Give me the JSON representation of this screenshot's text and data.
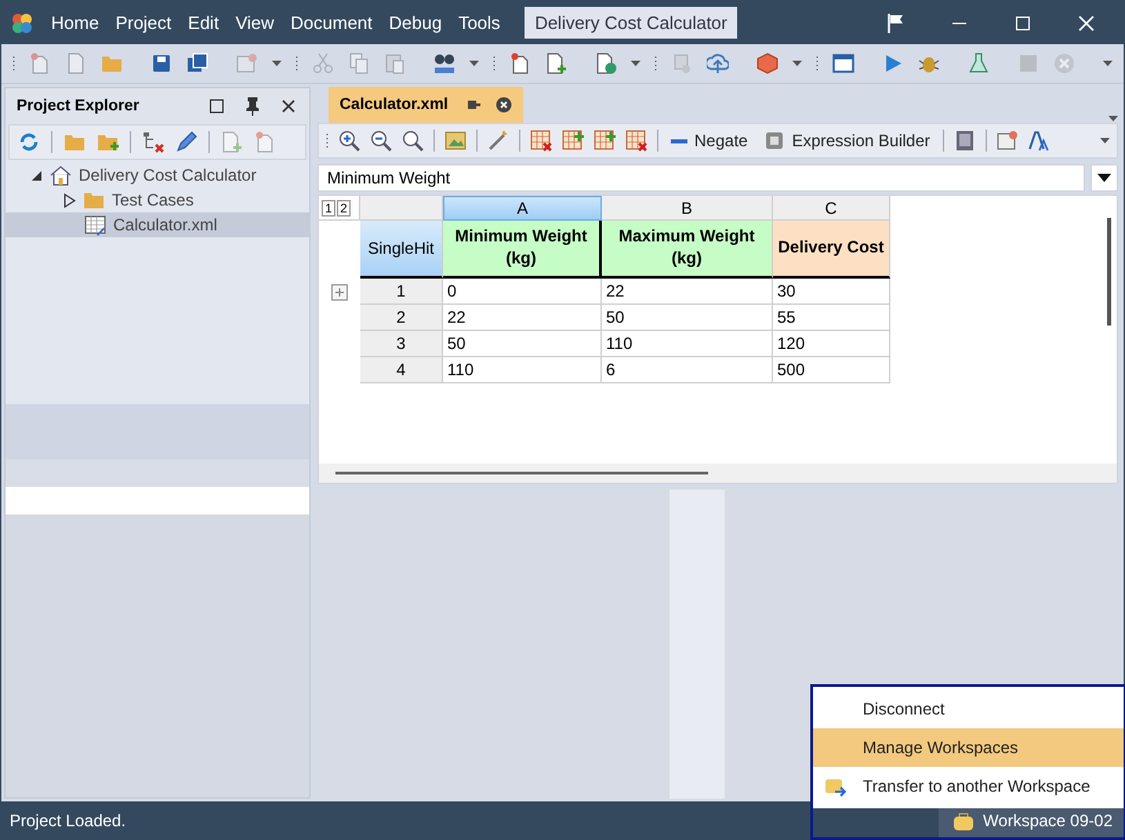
{
  "window": {
    "title": "Delivery Cost Calculator"
  },
  "menu": [
    "Home",
    "Project",
    "Edit",
    "View",
    "Document",
    "Debug",
    "Tools"
  ],
  "project_explorer": {
    "title": "Project Explorer",
    "tree": [
      {
        "label": "Delivery Cost Calculator",
        "kind": "project",
        "expanded": true,
        "selected": false,
        "children": [
          {
            "label": "Test Cases",
            "kind": "folder",
            "expanded": false,
            "selected": false
          },
          {
            "label": "Calculator.xml",
            "kind": "table",
            "selected": true
          }
        ]
      }
    ]
  },
  "document_tabs": [
    {
      "label": "Calculator.xml",
      "selected": true
    }
  ],
  "editor_toolbar": {
    "buttons": [
      "Negate",
      "Expression Builder"
    ]
  },
  "field_selector": {
    "value": "Minimum Weight"
  },
  "table": {
    "outline_levels": [
      "1",
      "2"
    ],
    "hit_policy": "SingleHit",
    "columns": [
      {
        "letter": "A",
        "header": "Minimum Weight (kg)",
        "color": "#c6fcc6",
        "selected": true
      },
      {
        "letter": "B",
        "header": "Maximum Weight (kg)",
        "color": "#c6fcc6",
        "selected": false
      },
      {
        "letter": "C",
        "header": "Delivery Cost",
        "color": "#fde0c4",
        "selected": false
      }
    ],
    "rows": [
      {
        "number": "1",
        "cells": [
          "0",
          "22",
          "30"
        ]
      },
      {
        "number": "2",
        "cells": [
          "22",
          "50",
          "55"
        ]
      },
      {
        "number": "3",
        "cells": [
          "50",
          "110",
          "120"
        ]
      },
      {
        "number": "4",
        "cells": [
          "110",
          "6",
          "500"
        ]
      }
    ]
  },
  "workspace_menu": [
    {
      "label": "Disconnect",
      "kind": "plain",
      "selected": false
    },
    {
      "label": "Manage Workspaces",
      "kind": "plain",
      "selected": true
    },
    {
      "label": "Transfer to another Workspace",
      "kind": "transfer",
      "selected": false
    }
  ],
  "status_bar": {
    "message": "Project Loaded.",
    "workspace": "Workspace 09-02"
  }
}
